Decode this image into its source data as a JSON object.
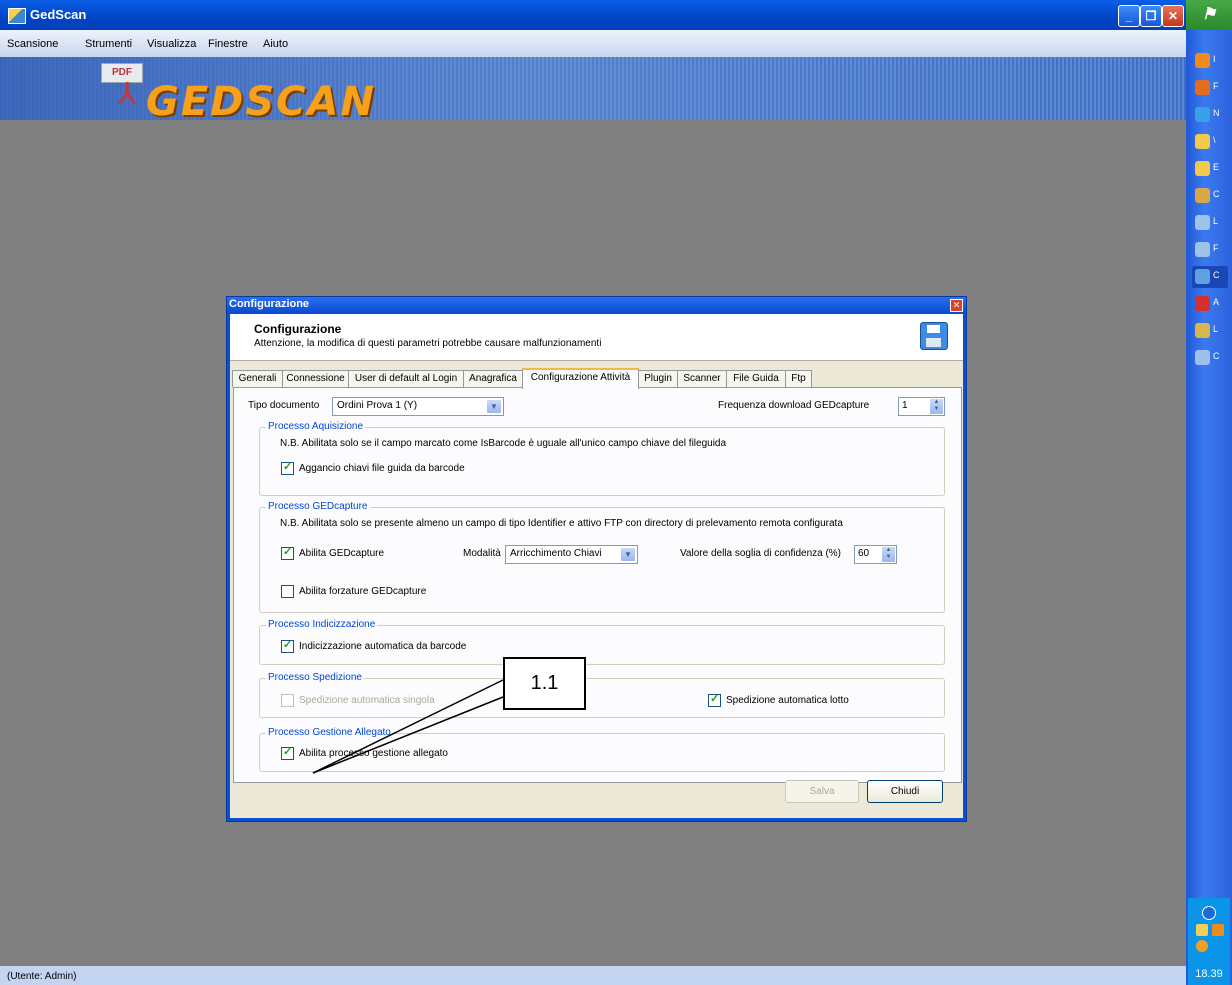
{
  "window": {
    "title": "GedScan"
  },
  "menu": [
    "Scansione",
    "Strumenti",
    "Visualizza",
    "Finestre",
    "Aiuto"
  ],
  "banner": {
    "pdf_label": "PDF",
    "logo_text": "GEDSCAN"
  },
  "status": {
    "text": "(Utente: Admin)"
  },
  "taskbar": {
    "items": [
      {
        "letter": "I",
        "icon": "outlook-icon",
        "color": "#f08a1a"
      },
      {
        "letter": "F",
        "icon": "firefox-icon",
        "color": "#e56b1f"
      },
      {
        "letter": "N",
        "icon": "ie-icon",
        "color": "#3aa0e8"
      },
      {
        "letter": "\\",
        "icon": "folder-icon",
        "color": "#f2c94a"
      },
      {
        "letter": "E",
        "icon": "folder-icon",
        "color": "#f2c94a"
      },
      {
        "letter": "C",
        "icon": "network-icon",
        "color": "#d9a64a"
      },
      {
        "letter": "L",
        "icon": "document-icon",
        "color": "#9ec2e8"
      },
      {
        "letter": "F",
        "icon": "document-icon",
        "color": "#9ec2e8"
      },
      {
        "letter": "C",
        "icon": "gedscan-icon",
        "color": "#5fa0e0"
      },
      {
        "letter": "A",
        "icon": "error-icon",
        "color": "#d62f2f"
      },
      {
        "letter": "L",
        "icon": "paint-icon",
        "color": "#d7b64a"
      },
      {
        "letter": "C",
        "icon": "monitor-icon",
        "color": "#9fc0ea"
      }
    ],
    "clock": "18.39"
  },
  "dialog": {
    "title": "Configurazione",
    "header_title": "Configurazione",
    "header_subtitle": "Attenzione, la modifica di questi parametri potrebbe causare malfunzionamenti",
    "tabs": [
      "Generali",
      "Connessione",
      "User di default al Login",
      "Anagrafica",
      "Configurazione Attività",
      "Plugin",
      "Scanner",
      "File Guida",
      "Ftp"
    ],
    "active_tab": "Configurazione Attività",
    "tipo_documento": {
      "label": "Tipo documento",
      "value": "Ordini Prova 1 (Y)"
    },
    "frequenza": {
      "label": "Frequenza download GEDcapture",
      "value": "1"
    },
    "acquisizione": {
      "title": "Processo Aquisizione",
      "note": "N.B. Abilitata solo se il campo marcato come IsBarcode è uguale all'unico campo chiave del fileguida",
      "checkbox": {
        "label": "Aggancio chiavi file guida da barcode",
        "checked": true
      }
    },
    "gedcapture": {
      "title": "Processo GEDcapture",
      "note": "N.B. Abilitata solo se presente almeno un campo di tipo Identifier e attivo FTP con directory di prelevamento remota configurata",
      "abilita": {
        "label": "Abilita GEDcapture",
        "checked": true
      },
      "modalita": {
        "label": "Modalità",
        "value": "Arricchimento Chiavi"
      },
      "soglia": {
        "label": "Valore della soglia di confidenza (%)",
        "value": "60"
      },
      "forzature": {
        "label": "Abilita forzature GEDcapture",
        "checked": false
      }
    },
    "indicizzazione": {
      "title": "Processo Indicizzazione",
      "checkbox": {
        "label": "Indicizzazione automatica da barcode",
        "checked": true
      }
    },
    "spedizione": {
      "title": "Processo Spedizione",
      "singola": {
        "label": "Spedizione automatica singola",
        "checked": false,
        "enabled": false
      },
      "lotto": {
        "label": "Spedizione automatica lotto",
        "checked": true
      }
    },
    "allegato": {
      "title": "Processo Gestione Allegato",
      "checkbox": {
        "label": "Abilita processo gestione allegato",
        "checked": true
      }
    },
    "buttons": {
      "save": "Salva",
      "close": "Chiudi"
    }
  },
  "annotation": {
    "label": "1.1"
  }
}
